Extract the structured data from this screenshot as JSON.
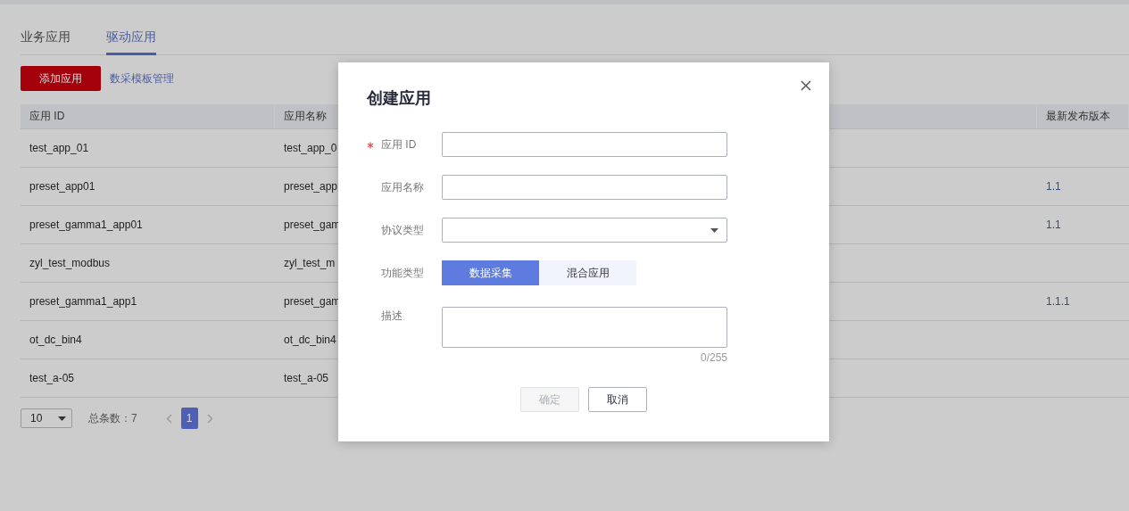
{
  "tabs": [
    {
      "label": "业务应用",
      "selected": false
    },
    {
      "label": "驱动应用",
      "selected": true
    }
  ],
  "toolbar": {
    "add_button": "添加应用",
    "template_link": "数采模板管理"
  },
  "table": {
    "columns": [
      "应用 ID",
      "应用名称",
      "最新发布版本"
    ],
    "rows": [
      {
        "app_id": "test_app_01",
        "app_name": "test_app_0"
      },
      {
        "app_id": "preset_app01",
        "app_name": "preset_app",
        "latest_version": "1.1"
      },
      {
        "app_id": "preset_gamma1_app01",
        "app_name": "preset_gam",
        "latest_version": "1.1"
      },
      {
        "app_id": "zyl_test_modbus",
        "app_name": "zyl_test_m"
      },
      {
        "app_id": "preset_gamma1_app1",
        "app_name": "preset_gam",
        "latest_version": "1.1.1"
      },
      {
        "app_id": "ot_dc_bin4",
        "app_name": "ot_dc_bin4"
      },
      {
        "app_id": "test_a-05",
        "app_name": "test_a-05"
      }
    ]
  },
  "pagination": {
    "page_size": "10",
    "total": "总条数：7",
    "pages": [
      {
        "label": "1",
        "selected": true
      }
    ]
  },
  "dialog": {
    "title": "创建应用",
    "fields": [
      {
        "kind": "text",
        "label": "应用 ID",
        "required": true
      },
      {
        "kind": "text",
        "label": "应用名称",
        "required": false
      },
      {
        "kind": "select",
        "label": "协议类型",
        "required": false
      },
      {
        "kind": "segmented",
        "label": "功能类型",
        "required": false,
        "options": [
          {
            "label": "数据采集",
            "selected": true
          },
          {
            "label": "混合应用",
            "selected": false
          }
        ]
      },
      {
        "kind": "textarea",
        "label": "描述",
        "required": false,
        "counter": "0/255"
      }
    ],
    "buttons": [
      {
        "label": "确定",
        "disabled": true
      },
      {
        "label": "取消",
        "disabled": false
      }
    ]
  }
}
